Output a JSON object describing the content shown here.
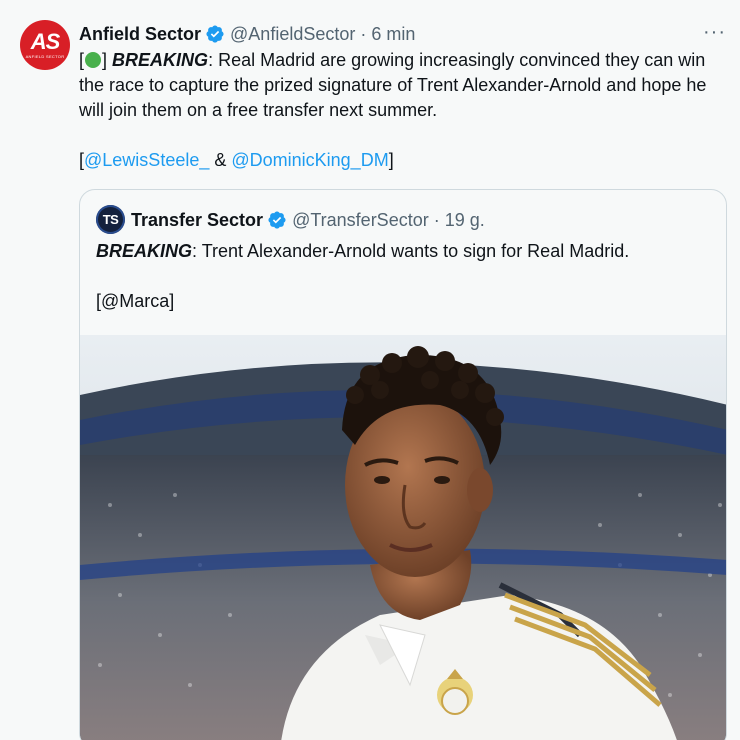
{
  "tweet": {
    "author_name": "Anfield Sector",
    "author_handle": "@AnfieldSector",
    "separator": "·",
    "time": "6 min",
    "more_label": "···",
    "avatar_initials": "AS",
    "avatar_subtext": "ANFIELD SECTOR",
    "bracket_open": "[",
    "bracket_close": "]",
    "breaking": "BREAKING",
    "text_main": ": Real Madrid are growing increasingly convinced they can win the race to capture the prized signature of Trent Alexander-Arnold and hope he will join them on a free transfer next summer.",
    "source_open": "[",
    "mention_1": "@LewisSteele_",
    "amp": " & ",
    "mention_2": "@DominicKing_DM",
    "source_close": "]"
  },
  "quote": {
    "author_name": "Transfer Sector",
    "author_handle": "@TransferSector",
    "separator": "·",
    "time": "19 g.",
    "avatar_initials": "TS",
    "breaking": "BREAKING",
    "text_main": ": Trent Alexander-Arnold wants to sign for Real Madrid.",
    "source": "[@Marca]"
  },
  "colors": {
    "link": "#1d9bf0",
    "verified": "#1d9bf0",
    "muted": "#536471",
    "emoji_green": "#48b04c"
  }
}
